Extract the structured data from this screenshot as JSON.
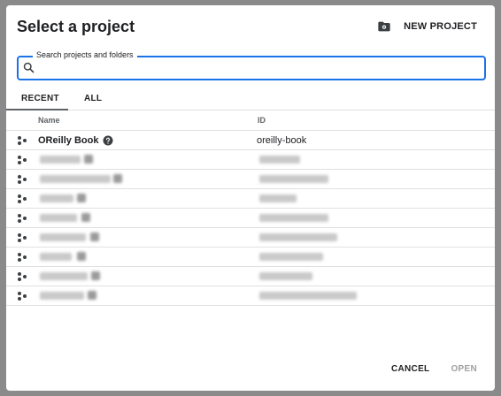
{
  "dialog": {
    "title": "Select a project",
    "new_project_label": "NEW PROJECT",
    "new_project_icon": "folder-settings-icon"
  },
  "search": {
    "label": "Search projects and folders",
    "placeholder": "",
    "value": ""
  },
  "tabs": [
    {
      "label": "RECENT",
      "selected": true
    },
    {
      "label": "ALL",
      "selected": false
    }
  ],
  "table": {
    "columns": [
      "Name",
      "ID"
    ],
    "rows": [
      {
        "name": "OReilly Book",
        "id": "oreilly-book",
        "has_help_icon": true,
        "redacted": false
      },
      {
        "name": "",
        "id": "",
        "redacted": true
      },
      {
        "name": "",
        "id": "",
        "redacted": true
      },
      {
        "name": "",
        "id": "",
        "redacted": true
      },
      {
        "name": "",
        "id": "",
        "redacted": true
      },
      {
        "name": "",
        "id": "",
        "redacted": true
      },
      {
        "name": "",
        "id": "",
        "redacted": true
      },
      {
        "name": "",
        "id": "",
        "redacted": true
      },
      {
        "name": "",
        "id": "",
        "redacted": true
      }
    ]
  },
  "footer": {
    "cancel_label": "CANCEL",
    "open_label": "OPEN"
  },
  "colors": {
    "accent": "#1a73e8",
    "text": "#202124",
    "muted": "#5f6368",
    "disabled": "#a0a0a0",
    "backdrop": "#8a8a8a"
  }
}
